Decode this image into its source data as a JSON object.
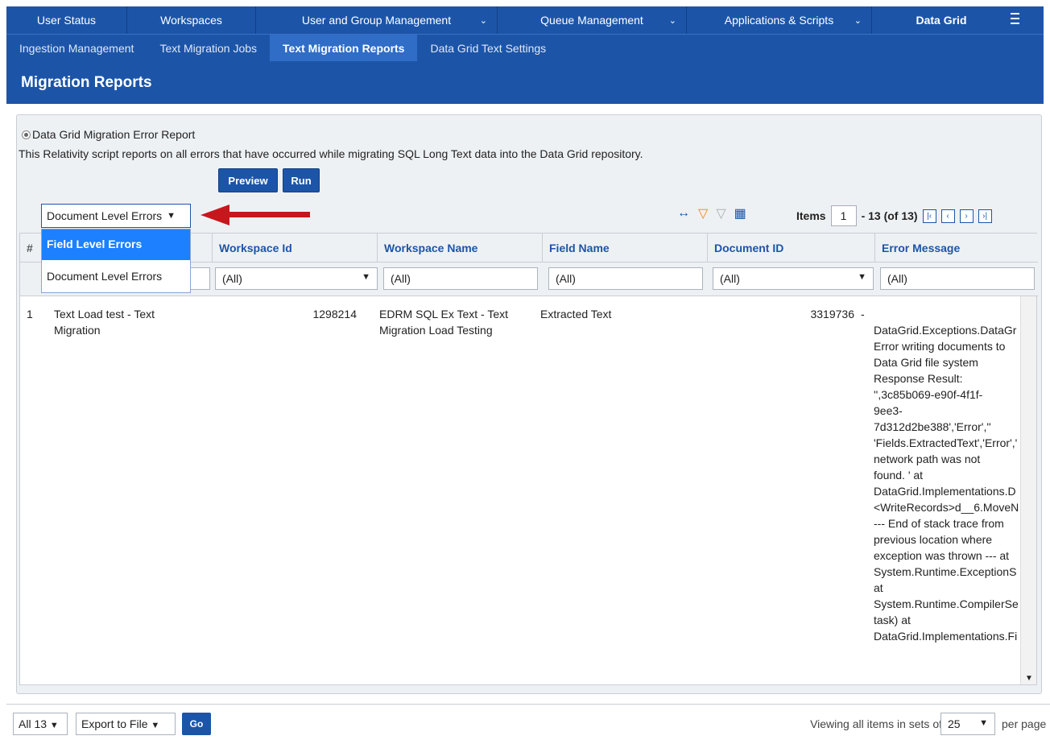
{
  "topnav": {
    "tabs": [
      "User Status",
      "Workspaces",
      "User and Group Management",
      "Queue Management",
      "Applications & Scripts"
    ],
    "active_tab": "Data Grid",
    "menu_icon": "hamburger-icon"
  },
  "subnav": {
    "tabs": [
      "Ingestion Management",
      "Text Migration Jobs",
      "Text Migration Reports",
      "Data Grid Text Settings"
    ]
  },
  "page_title": "Migration Reports",
  "report": {
    "name": "Data Grid Migration Error Report",
    "description": "This Relativity script reports on all errors that have occurred while migrating SQL Long Text data into the Data Grid repository.",
    "preview_label": "Preview",
    "run_label": "Run"
  },
  "level_select": {
    "value": "Document Level Errors",
    "options": [
      "Field Level Errors",
      "Document Level Errors"
    ]
  },
  "toolbar": {
    "icons": [
      "resize-columns-icon",
      "filter-icon",
      "clear-filter-icon",
      "grid-view-icon"
    ],
    "items_label": "Items",
    "page_input": "1",
    "range_text": "- 13 (of 13)"
  },
  "grid": {
    "columns": [
      "#",
      "Workspace Id",
      "Workspace Name",
      "Field Name",
      "Document ID",
      "Error Message"
    ],
    "filters": [
      "(All)",
      "(All)",
      "(All)",
      "(All)",
      "(All)"
    ],
    "rows": [
      {
        "num": "1",
        "col2_line1": "Text Load test - Text",
        "col2_line2": "Migration",
        "workspace_id": "1298214",
        "workspace_name_line1": "EDRM SQL Ex Text - Text",
        "workspace_name_line2": "Migration Load Testing",
        "field_name": "Extracted Text",
        "document_id": "3319736",
        "error_lines": [
          "-",
          "DataGrid.Exceptions.DataGr",
          "Error writing documents to",
          "Data Grid file system",
          "Response Result:",
          "'',3c85b069-e90f-4f1f-",
          "9ee3-",
          "7d312d2be388','Error',''",
          "'Fields.ExtractedText','Error','",
          "network path was not",
          "found. ' at",
          "DataGrid.Implementations.D",
          "<WriteRecords>d__6.MoveN",
          "--- End of stack trace from",
          "previous location where",
          "exception was thrown --- at",
          "System.Runtime.ExceptionS",
          "at",
          "System.Runtime.CompilerSe",
          "task) at",
          "DataGrid.Implementations.Fi"
        ]
      }
    ]
  },
  "footer": {
    "count_select": "All 13",
    "export_select": "Export to File",
    "go_label": "Go",
    "viewing_text": "Viewing all items in sets of",
    "per_page_value": "25",
    "per_page_label": "per page"
  }
}
